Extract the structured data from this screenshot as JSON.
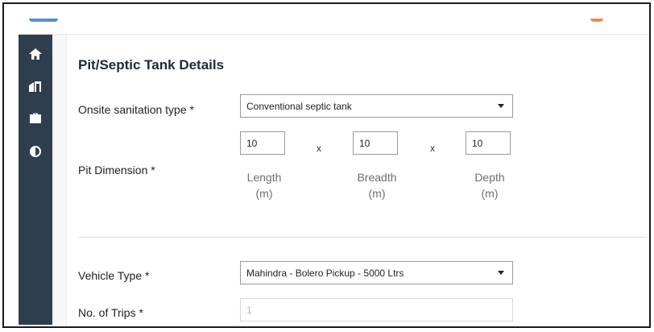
{
  "sidebar": {
    "items": [
      {
        "icon": "home-icon"
      },
      {
        "icon": "building-icon"
      },
      {
        "icon": "briefcase-icon"
      },
      {
        "icon": "drop-icon"
      }
    ]
  },
  "form": {
    "title": "Pit/Septic Tank Details",
    "sanitation": {
      "label": "Onsite sanitation type *",
      "value": "Conventional septic tank"
    },
    "pit_dimension": {
      "label": "Pit Dimension *",
      "separator": "x",
      "length": {
        "value": "10",
        "name": "Length",
        "unit": "(m)"
      },
      "breadth": {
        "value": "10",
        "name": "Breadth",
        "unit": "(m)"
      },
      "depth": {
        "value": "10",
        "name": "Depth",
        "unit": "(m)"
      }
    },
    "vehicle": {
      "label": "Vehicle Type *",
      "value": "Mahindra - Bolero Pickup - 5000 Ltrs"
    },
    "trips": {
      "label": "No. of Trips *",
      "value": "1"
    }
  },
  "colors": {
    "sidebar": "#2e3e4f",
    "accent": "#f08a4b",
    "brand": "#4f8fd6"
  }
}
